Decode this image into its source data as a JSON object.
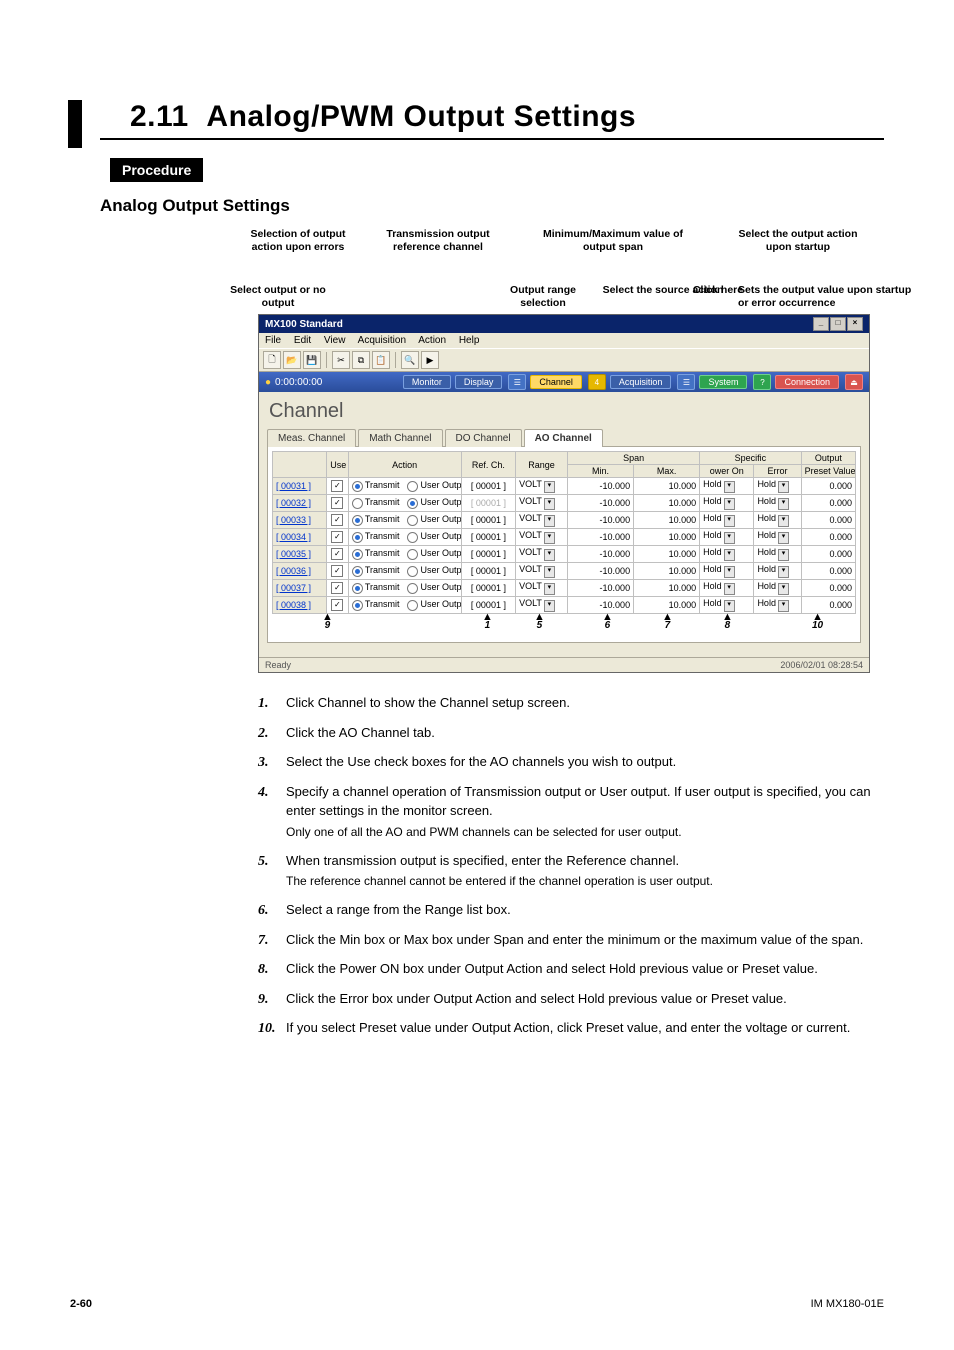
{
  "heading": {
    "number": "2.11",
    "title": "Analog/PWM Output Settings"
  },
  "procedure_label": "Procedure",
  "subheading": "Analog Output Settings",
  "annotations": {
    "a1_top": "Selection of output action upon errors",
    "a1_bot": "Select output or no output",
    "a2": "Transmission output reference channel",
    "a3_top": "Minimum/Maximum value of output span",
    "a3_bot": "Output range selection",
    "a4": "Select the source action",
    "a4b": "Click here",
    "a5_top": "Select the output action upon startup",
    "a5_bot": "Sets the output value upon startup or error occurrence"
  },
  "app": {
    "title": "MX100 Standard",
    "menus": [
      "File",
      "Edit",
      "View",
      "Acquisition",
      "Action",
      "Help"
    ],
    "recorder_time": "0:00:00:00",
    "toolbar2": {
      "monitor": "Monitor",
      "display": "Display",
      "channel": "Channel",
      "acquisition": "Acquisition",
      "system": "System",
      "connection": "Connection"
    },
    "body_title": "Channel",
    "tabs": [
      "Meas. Channel",
      "Math Channel",
      "DO Channel",
      "AO Channel"
    ],
    "grid_headers": {
      "use": "Use",
      "action": "Action",
      "ref": "Ref. Ch.",
      "range": "Range",
      "span": "Span",
      "min": "Min.",
      "max": "Max.",
      "specific": "Specific",
      "poweron": "ower On",
      "error": "Error",
      "output": "Output",
      "preset": "Preset Value"
    },
    "action_labels": {
      "transmit": "Transmit",
      "user": "User Output"
    },
    "rows": [
      {
        "ch": "[ 00031 ]",
        "use": true,
        "t": true,
        "ref": "[ 00001 ]",
        "range": "VOLT",
        "min": "-10.000",
        "max": "10.000",
        "pon": "Hold",
        "err": "Hold",
        "pv": "0.000"
      },
      {
        "ch": "[ 00032 ]",
        "use": true,
        "t": false,
        "ref": "[ 00001 ]",
        "range": "VOLT",
        "min": "-10.000",
        "max": "10.000",
        "pon": "Hold",
        "err": "Hold",
        "pv": "0.000"
      },
      {
        "ch": "[ 00033 ]",
        "use": true,
        "t": true,
        "ref": "[ 00001 ]",
        "range": "VOLT",
        "min": "-10.000",
        "max": "10.000",
        "pon": "Hold",
        "err": "Hold",
        "pv": "0.000"
      },
      {
        "ch": "[ 00034 ]",
        "use": true,
        "t": true,
        "ref": "[ 00001 ]",
        "range": "VOLT",
        "min": "-10.000",
        "max": "10.000",
        "pon": "Hold",
        "err": "Hold",
        "pv": "0.000"
      },
      {
        "ch": "[ 00035 ]",
        "use": true,
        "t": true,
        "ref": "[ 00001 ]",
        "range": "VOLT",
        "min": "-10.000",
        "max": "10.000",
        "pon": "Hold",
        "err": "Hold",
        "pv": "0.000"
      },
      {
        "ch": "[ 00036 ]",
        "use": true,
        "t": true,
        "ref": "[ 00001 ]",
        "range": "VOLT",
        "min": "-10.000",
        "max": "10.000",
        "pon": "Hold",
        "err": "Hold",
        "pv": "0.000"
      },
      {
        "ch": "[ 00037 ]",
        "use": true,
        "t": true,
        "ref": "[ 00001 ]",
        "range": "VOLT",
        "min": "-10.000",
        "max": "10.000",
        "pon": "Hold",
        "err": "Hold",
        "pv": "0.000"
      },
      {
        "ch": "[ 00038 ]",
        "use": true,
        "t": true,
        "ref": "[ 00001 ]",
        "range": "VOLT",
        "min": "-10.000",
        "max": "10.000",
        "pon": "Hold",
        "err": "Hold",
        "pv": "0.000"
      }
    ],
    "callouts": [
      "9",
      "1",
      "5",
      "6",
      "7",
      "8",
      "10"
    ],
    "status_left": "Ready",
    "status_right": "2006/02/01 08:28:54"
  },
  "steps": [
    {
      "n": "1.",
      "t": "Click Channel to show the Channel setup screen."
    },
    {
      "n": "2.",
      "t": "Click the AO Channel tab."
    },
    {
      "n": "3.",
      "t": "Select the Use check boxes for the AO channels you wish to output."
    },
    {
      "n": "4.",
      "t": "Specify a channel operation of Transmission output or User output. If user output is specified, you can enter settings in the monitor screen.",
      "s": "Only one of all the AO and PWM channels can be selected for user output."
    },
    {
      "n": "5.",
      "t": "When transmission output is specified, enter the Reference channel.",
      "s": "The reference channel cannot be entered if the channel operation is user output."
    },
    {
      "n": "6.",
      "t": "Select a range from the Range list box."
    },
    {
      "n": "7.",
      "t": "Click the Min box or Max box under Span and enter the minimum or the maximum value of the span."
    },
    {
      "n": "8.",
      "t": "Click the Power ON box under Output Action and select Hold previous value or Preset value."
    },
    {
      "n": "9.",
      "t": "Click the Error box under Output Action and select Hold previous value or Preset value."
    },
    {
      "n": "10.",
      "t": "If you select Preset value under Output Action, click Preset value, and enter the voltage or current."
    }
  ],
  "footer": {
    "page": "2-60",
    "doc": "IM MX180-01E"
  }
}
